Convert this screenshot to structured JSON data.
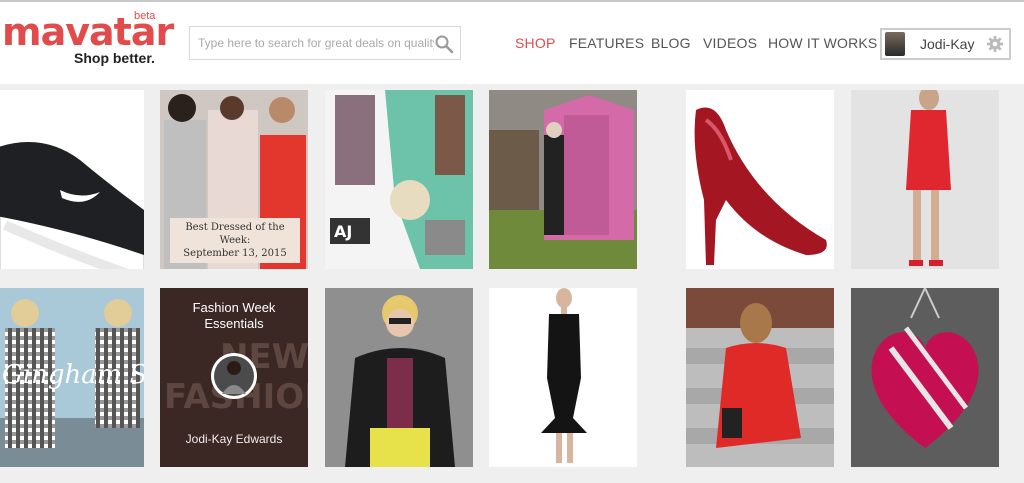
{
  "header": {
    "logo": {
      "wordmark": "mavatar",
      "badge": "beta",
      "tagline": "Shop better."
    },
    "search": {
      "placeholder": "Type here to search for great deals on quality products"
    },
    "nav": [
      {
        "label": "SHOP",
        "active": true
      },
      {
        "label": "FEATURES",
        "active": false
      },
      {
        "label": "BLOG",
        "active": false
      },
      {
        "label": "VIDEOS",
        "active": false
      },
      {
        "label": "HOW IT WORKS",
        "active": false
      }
    ],
    "user": {
      "name": "Jodi-Kay",
      "settings_icon": "gear-icon"
    }
  },
  "colors": {
    "brand": "#e24b4b",
    "background": "#efefef"
  },
  "tiles": {
    "best_dressed": {
      "caption_line1": "Best Dressed of the Week:",
      "caption_line2": "September 13, 2015"
    },
    "collage": {
      "label": "AJ"
    },
    "gingham": {
      "overlay": "Gingham Style"
    },
    "fashion_week": {
      "title_line1": "Fashion Week",
      "title_line2": "Essentials",
      "background_text_1": "NEW Y",
      "background_text_2": "FASHION",
      "author": "Jodi-Kay Edwards"
    }
  }
}
